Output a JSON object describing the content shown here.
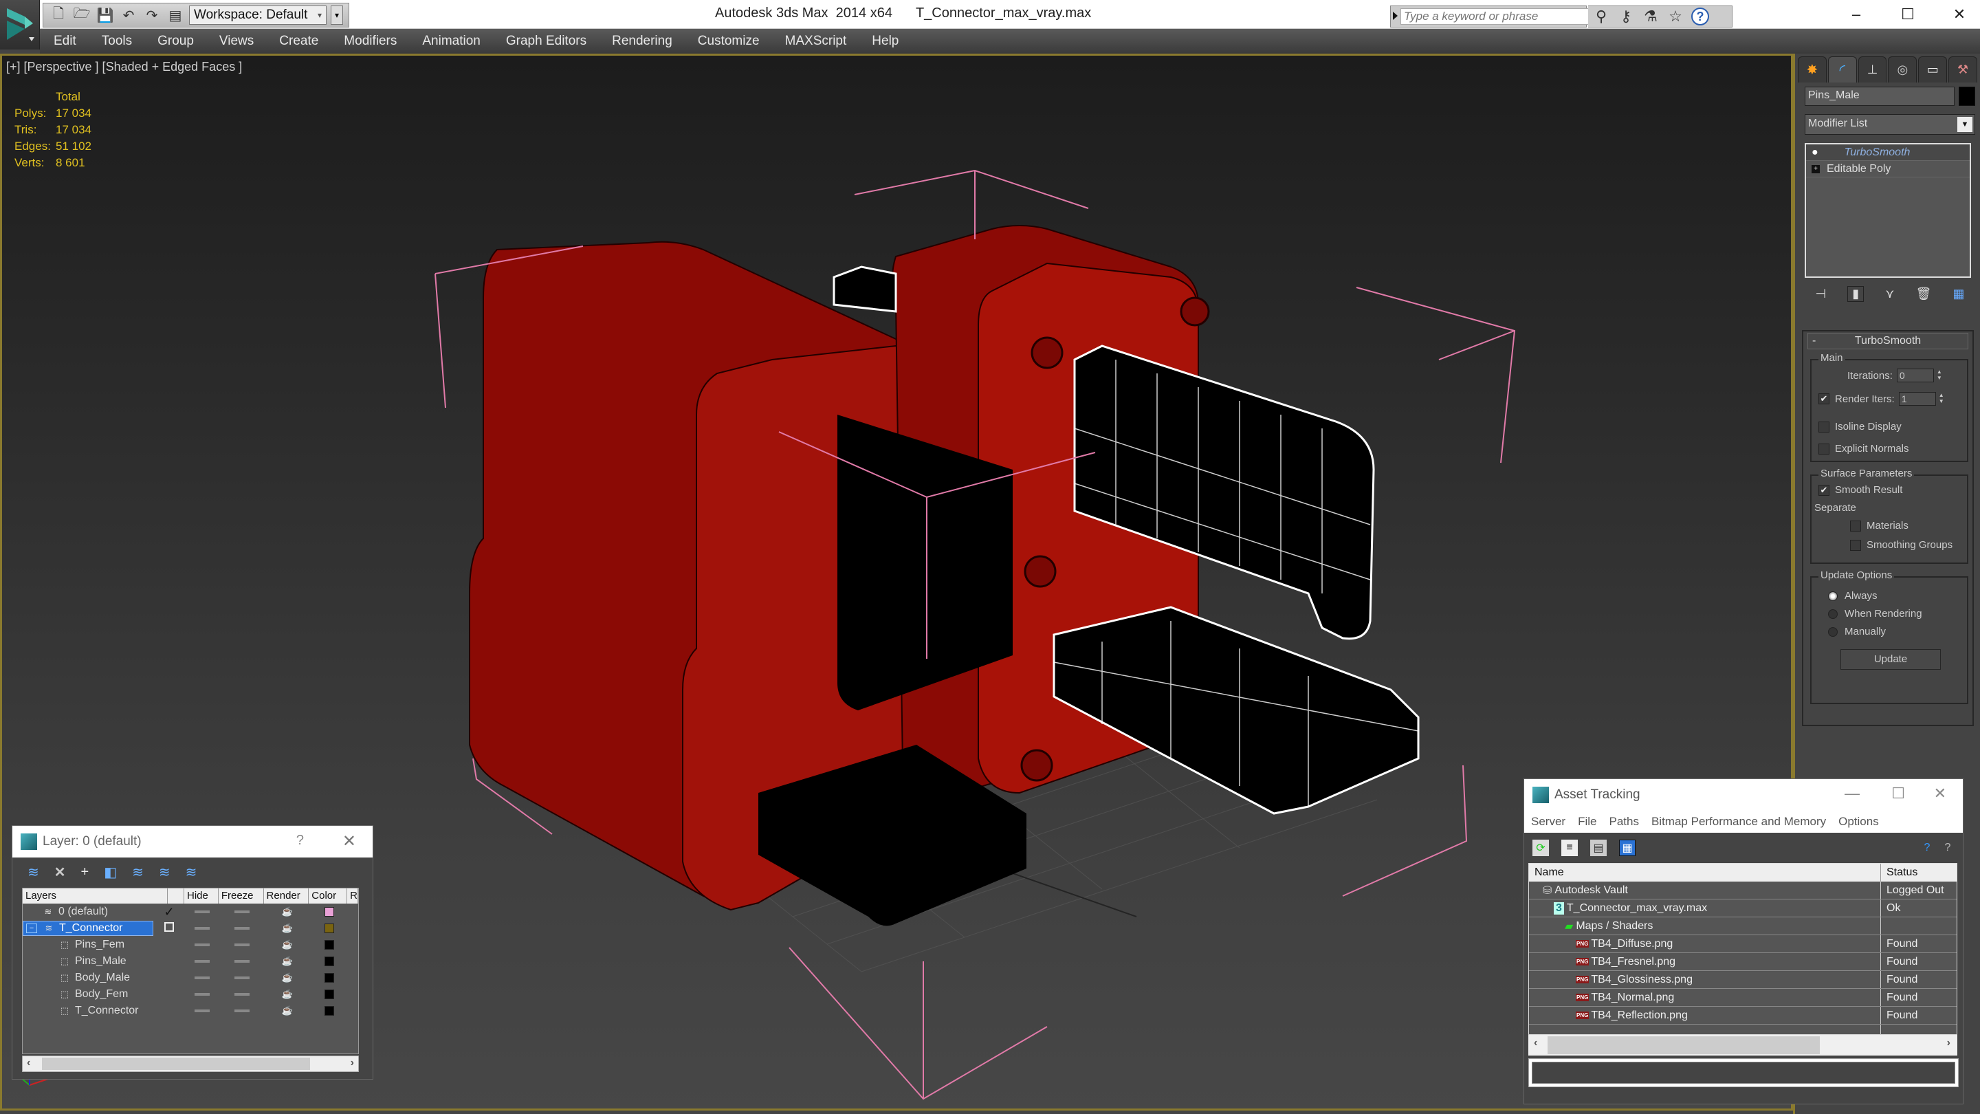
{
  "titlebar": {
    "app_name": "Autodesk 3ds Max  2014 x64",
    "file_name": "T_Connector_max_vray.max",
    "workspace": "Workspace: Default",
    "search_placeholder": "Type a keyword or phrase",
    "minimize": "–",
    "maximize": "☐",
    "close": "✕"
  },
  "menu": [
    "Edit",
    "Tools",
    "Group",
    "Views",
    "Create",
    "Modifiers",
    "Animation",
    "Graph Editors",
    "Rendering",
    "Customize",
    "MAXScript",
    "Help"
  ],
  "viewport": {
    "label": "[+] [Perspective ] [Shaded + Edged Faces ]",
    "stats": {
      "header": "Total",
      "rows": [
        {
          "key": "Polys:",
          "value": "17 034"
        },
        {
          "key": "Tris:",
          "value": "17 034"
        },
        {
          "key": "Edges:",
          "value": "51 102"
        },
        {
          "key": "Verts:",
          "value": "8 601"
        }
      ]
    },
    "colors": {
      "body": "#8b0a05",
      "pins": "#000000",
      "selection_bracket": "#e17aa8",
      "wireframe": "#ffffff"
    }
  },
  "command_panel": {
    "object_name": "Pins_Male",
    "object_color": "#000000",
    "modifier_list": "Modifier List",
    "stack": [
      {
        "label": "TurboSmooth",
        "type": "modifier"
      },
      {
        "label": "Editable Poly",
        "type": "base"
      }
    ],
    "turbosmooth": {
      "title": "TurboSmooth",
      "collapse": "-",
      "main_group": "Main",
      "iterations_label": "Iterations:",
      "iterations_value": "0",
      "render_iters_label": "Render Iters:",
      "render_iters_value": "1",
      "render_iters_checked": true,
      "isoline_label": "Isoline Display",
      "isoline_checked": false,
      "explicit_normals_label": "Explicit Normals",
      "explicit_normals_checked": false,
      "surface_group": "Surface Parameters",
      "smooth_result_label": "Smooth Result",
      "smooth_result_checked": true,
      "separate_label": "Separate",
      "materials_label": "Materials",
      "smoothing_groups_label": "Smoothing Groups",
      "update_group": "Update Options",
      "update_options": [
        {
          "label": "Always",
          "selected": true
        },
        {
          "label": "When Rendering",
          "selected": false
        },
        {
          "label": "Manually",
          "selected": false
        }
      ],
      "update_button": "Update"
    }
  },
  "layer_dialog": {
    "title": "Layer: 0 (default)",
    "help": "?",
    "close": "✕",
    "columns": [
      "Layers",
      "",
      "Hide",
      "Freeze",
      "Render",
      "Color",
      "R"
    ],
    "rows": [
      {
        "name": "0 (default)",
        "kind": "layer",
        "current": true,
        "color": "#e9a1d6",
        "selected": false
      },
      {
        "name": "T_Connector",
        "kind": "layer",
        "current": false,
        "color": "#7a6410",
        "selected": true
      },
      {
        "name": "Pins_Fem",
        "kind": "object",
        "color": "#000000",
        "selected": false
      },
      {
        "name": "Pins_Male",
        "kind": "object",
        "color": "#000000",
        "selected": false
      },
      {
        "name": "Body_Male",
        "kind": "object",
        "color": "#000000",
        "selected": false
      },
      {
        "name": "Body_Fem",
        "kind": "object",
        "color": "#000000",
        "selected": false
      },
      {
        "name": "T_Connector",
        "kind": "object",
        "color": "#000000",
        "selected": false
      }
    ]
  },
  "asset_dialog": {
    "title": "Asset Tracking",
    "menu": [
      "Server",
      "File",
      "Paths",
      "Bitmap Performance and Memory",
      "Options"
    ],
    "columns": [
      "Name",
      "Status"
    ],
    "rows": [
      {
        "name": "Autodesk Vault",
        "status": "Logged Out",
        "indent": 1,
        "icon": "vault"
      },
      {
        "name": "T_Connector_max_vray.max",
        "status": "Ok",
        "indent": 2,
        "icon": "max"
      },
      {
        "name": "Maps / Shaders",
        "status": "",
        "indent": 3,
        "icon": "maps"
      },
      {
        "name": "TB4_Diffuse.png",
        "status": "Found",
        "indent": 4,
        "icon": "png"
      },
      {
        "name": "TB4_Fresnel.png",
        "status": "Found",
        "indent": 4,
        "icon": "png"
      },
      {
        "name": "TB4_Glossiness.png",
        "status": "Found",
        "indent": 4,
        "icon": "png"
      },
      {
        "name": "TB4_Normal.png",
        "status": "Found",
        "indent": 4,
        "icon": "png"
      },
      {
        "name": "TB4_Reflection.png",
        "status": "Found",
        "indent": 4,
        "icon": "png"
      }
    ]
  }
}
